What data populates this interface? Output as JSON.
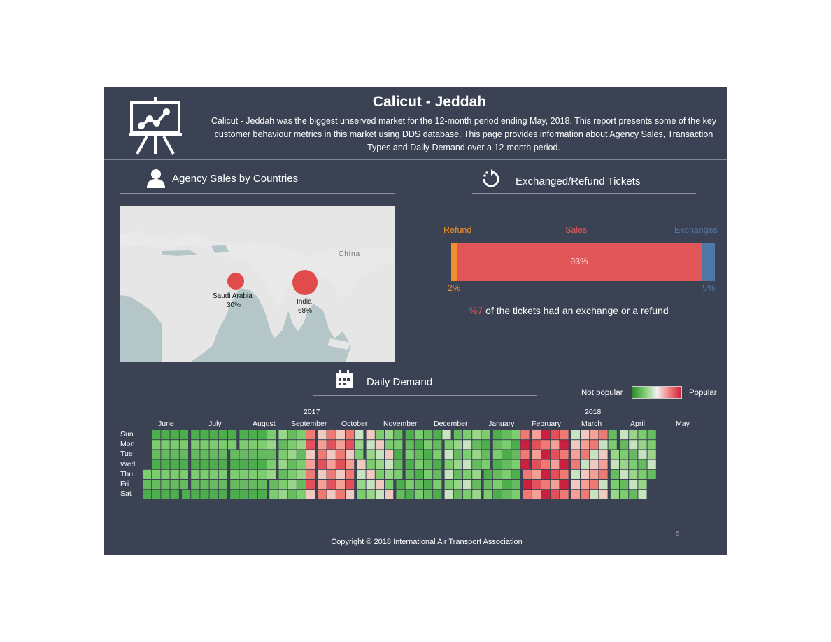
{
  "header": {
    "title": "Calicut - Jeddah",
    "subtitle": "Calicut - Jeddah was the biggest unserved market for the 12-month period ending May, 2018. This report presents some of the key customer behaviour metrics in this market using DDS database.  This page provides information about Agency Sales, Transaction Types and Daily Demand over a 12-month period."
  },
  "agency": {
    "title": "Agency Sales by Countries",
    "map": {
      "label_china": "China",
      "countries": [
        {
          "name": "Saudi Arabia",
          "pct": "30%",
          "share": 0.3
        },
        {
          "name": "India",
          "pct": "68%",
          "share": 0.68
        }
      ]
    }
  },
  "tickets": {
    "title": "Exchanged/Refund Tickets",
    "refund_label": "Refund",
    "sales_label": "Sales",
    "exchanges_label": "Exchanges",
    "refund_pct": "2%",
    "sales_pct": "93%",
    "exchanges_pct": "5%",
    "note_value": "%7",
    "note_text": " of the tickets had an exchange or a refund",
    "colors": {
      "refund": "#f28e2b",
      "sales": "#e15759",
      "exchanges": "#4e79a7"
    }
  },
  "demand": {
    "title": "Daily Demand",
    "legend_low": "Not popular",
    "legend_high": "Popular",
    "year_2017": "2017",
    "year_2018": "2018",
    "months": [
      "June",
      "July",
      "August",
      "September",
      "October",
      "November",
      "December",
      "January",
      "February",
      "March",
      "April",
      "May"
    ],
    "days": [
      "Sun",
      "Mon",
      "Tue",
      "Wed",
      "Thu",
      "Fri",
      "Sat"
    ]
  },
  "footer": {
    "copyright": "Copyright © 2018 International Air Transport Association",
    "page": "5"
  }
}
